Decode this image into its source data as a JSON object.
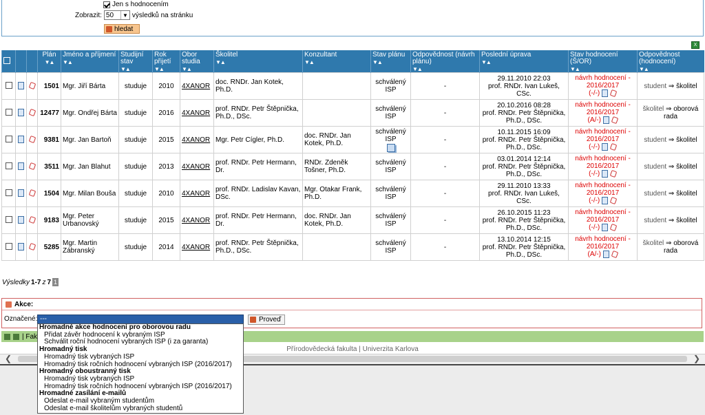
{
  "filter": {
    "only_rated_label": "Jen s hodnocením",
    "show_label": "Zobrazit:",
    "per_page_value": "50",
    "per_page_suffix": "výsledků na stránku",
    "search_button": "hledat"
  },
  "table": {
    "columns": [
      "Plán",
      "Jméno a příjmení",
      "Studijní stav",
      "Rok přijetí",
      "Obor studia",
      "Školitel",
      "Konzultant",
      "Stav plánu",
      "Odpovědnost (návrh plánu)",
      "Poslední úprava",
      "Stav hodnocení (Š/OR)",
      "Odpovědnost (hodnocení)"
    ],
    "sort_arrows": "▼▲",
    "rows": [
      {
        "plan": "1501",
        "name": "Mgr. Jiří Bárta",
        "stav": "studuje",
        "rok": "2010",
        "obor": "4XANOR",
        "skolitel": "doc. RNDr. Jan Kotek, Ph.D.",
        "konzultant": "",
        "stav_planu": "schválený ISP",
        "odpovednost_plan": "-",
        "uprava_date": "29.11.2010 22:03",
        "uprava_by": "prof. RNDr. Ivan Lukeš, CSc.",
        "hodnoceni": "návrh hodnocení - 2016/2017",
        "hodnoceni_code": "(-/-)",
        "odp_from": "student",
        "odp_to": "školitel"
      },
      {
        "plan": "12477",
        "name": "Mgr. Ondřej Bárta",
        "stav": "studuje",
        "rok": "2016",
        "obor": "4XANOR",
        "skolitel": "prof. RNDr. Petr Štěpnička, Ph.D., DSc.",
        "konzultant": "",
        "stav_planu": "schválený ISP",
        "odpovednost_plan": "-",
        "uprava_date": "20.10.2016 08:28",
        "uprava_by": "prof. RNDr. Petr Štěpnička, Ph.D., DSc.",
        "hodnoceni": "návrh hodnocení - 2016/2017",
        "hodnoceni_code": "(A/-)",
        "odp_from": "školitel",
        "odp_to": "oborová rada"
      },
      {
        "plan": "9381",
        "name": "Mgr. Jan Bartoň",
        "stav": "studuje",
        "rok": "2015",
        "obor": "4XANOR",
        "skolitel": "Mgr. Petr Cígler, Ph.D.",
        "konzultant": "doc. RNDr. Jan Kotek, Ph.D.",
        "stav_planu": "schválený ISP",
        "odpovednost_plan": "-",
        "uprava_date": "10.11.2015 16:09",
        "uprava_by": "prof. RNDr. Petr Štěpnička, Ph.D., DSc.",
        "hodnoceni": "návrh hodnocení - 2016/2017",
        "hodnoceni_code": "(-/-)",
        "odp_from": "student",
        "odp_to": "školitel"
      },
      {
        "plan": "3511",
        "name": "Mgr. Jan Blahut",
        "stav": "studuje",
        "rok": "2013",
        "obor": "4XANOR",
        "skolitel": "prof. RNDr. Petr Hermann, Dr.",
        "konzultant": "RNDr. Zdeněk Tošner, Ph.D.",
        "stav_planu": "schválený ISP",
        "odpovednost_plan": "-",
        "uprava_date": "03.01.2014 12:14",
        "uprava_by": "prof. RNDr. Petr Štěpnička, Ph.D., DSc.",
        "hodnoceni": "návrh hodnocení - 2016/2017",
        "hodnoceni_code": "(-/-)",
        "odp_from": "student",
        "odp_to": "školitel"
      },
      {
        "plan": "1504",
        "name": "Mgr. Milan Bouša",
        "stav": "studuje",
        "rok": "2010",
        "obor": "4XANOR",
        "skolitel": "prof. RNDr. Ladislav Kavan, DSc.",
        "konzultant": "Mgr. Otakar Frank, Ph.D.",
        "stav_planu": "schválený ISP",
        "odpovednost_plan": "-",
        "uprava_date": "29.11.2010 13:33",
        "uprava_by": "prof. RNDr. Ivan Lukeš, CSc.",
        "hodnoceni": "návrh hodnocení - 2016/2017",
        "hodnoceni_code": "(-/-)",
        "odp_from": "student",
        "odp_to": "školitel"
      },
      {
        "plan": "9183",
        "name": "Mgr. Peter Urbanovský",
        "stav": "studuje",
        "rok": "2015",
        "obor": "4XANOR",
        "skolitel": "prof. RNDr. Petr Hermann, Dr.",
        "konzultant": "doc. RNDr. Jan Kotek, Ph.D.",
        "stav_planu": "schválený ISP",
        "odpovednost_plan": "-",
        "uprava_date": "26.10.2015 11:23",
        "uprava_by": "prof. RNDr. Petr Štěpnička, Ph.D., DSc.",
        "hodnoceni": "návrh hodnocení - 2016/2017",
        "hodnoceni_code": "(-/-)",
        "odp_from": "student",
        "odp_to": "školitel"
      },
      {
        "plan": "5285",
        "name": "Mgr. Martin Zábranský",
        "stav": "studuje",
        "rok": "2014",
        "obor": "4XANOR",
        "skolitel": "prof. RNDr. Petr Štěpnička, Ph.D., DSc.",
        "konzultant": "",
        "stav_planu": "schválený ISP",
        "odpovednost_plan": "-",
        "uprava_date": "13.10.2014 12:15",
        "uprava_by": "prof. RNDr. Petr Štěpnička, Ph.D., DSc.",
        "hodnoceni": "návrh hodnocení - 2016/2017",
        "hodnoceni_code": "(A/-)",
        "odp_from": "školitel",
        "odp_to": "oborová rada"
      }
    ]
  },
  "results": {
    "label": "Výsledky",
    "range": "1-7",
    "of": "z",
    "total": "7",
    "page": "1"
  },
  "actions": {
    "title": "Akce:",
    "marked_label": "Označené:",
    "selected_value": "---",
    "run_button": "Proveď",
    "dropdown": [
      {
        "group": "Hromadné akce hodnocení pro oborovou radu",
        "options": [
          "Přidat závěr hodnocení k vybraným ISP",
          "Schválit roční hodnocení vybraných ISP (i za garanta)"
        ]
      },
      {
        "group": "Hromadný tisk",
        "options": [
          "Hromadný tisk vybraných ISP",
          "Hromadný tisk ročních hodnocení vybraných ISP (2016/2017)"
        ]
      },
      {
        "group": "Hromadný oboustranný tisk",
        "options": [
          "Hromadný tisk vybraných ISP",
          "Hromadný tisk ročních hodnocení vybraných ISP (2016/2017)"
        ]
      },
      {
        "group": "Hromadné zasílání e-mailů",
        "options": [
          "Odeslat e-mail vybraným studentům",
          "Odeslat e-mail školitelům vybraných studentů"
        ]
      }
    ]
  },
  "greenbar": {
    "text": "| Fak"
  },
  "footer": {
    "faculty": "Přírodovědecká fakulta",
    "sep": "|",
    "university": "Univerzita Karlova"
  },
  "colors": {
    "header_blue": "#2f79ad",
    "red": "#dd0000",
    "green_bar": "#a8d28a"
  }
}
